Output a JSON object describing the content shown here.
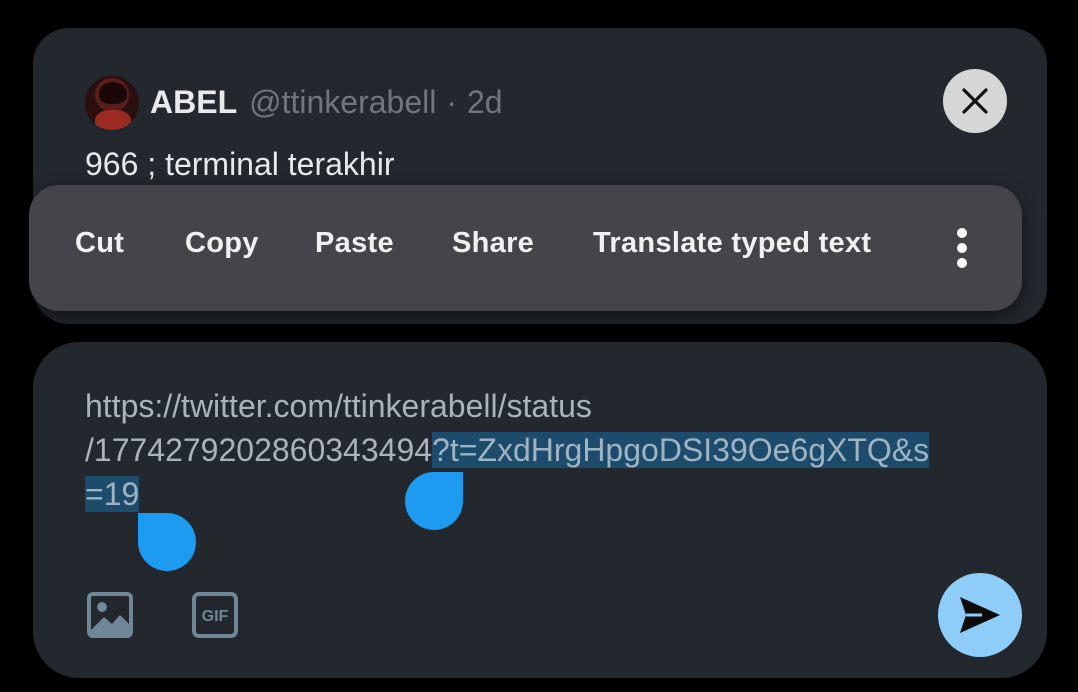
{
  "tweet": {
    "display_name": "ABEL",
    "handle": "@ttinkerabell",
    "separator": "·",
    "time": "2d",
    "text": "966 ; terminal terakhir"
  },
  "context_menu": {
    "items": [
      "Cut",
      "Copy",
      "Paste",
      "Share",
      "Translate typed text"
    ],
    "more_icon": "more-vertical-icon"
  },
  "compose": {
    "line1": "https://twitter.com/ttinkerabell/status",
    "line2_unselected": "/1774279202860343494",
    "line2_selected": "?t=ZxdHrgHpgoDSI39Oe6gXTQ&s",
    "line3_selected": "=19",
    "icons": [
      "image-icon",
      "gif-icon"
    ],
    "send_icon": "send-icon"
  },
  "colors": {
    "card_bg": "#23282e",
    "menu_bg": "#43454a",
    "accent": "#1d9bf0",
    "send_bg": "#8ecdf8",
    "selection_bg": "#1d4b6b",
    "muted_text": "#71767b"
  }
}
